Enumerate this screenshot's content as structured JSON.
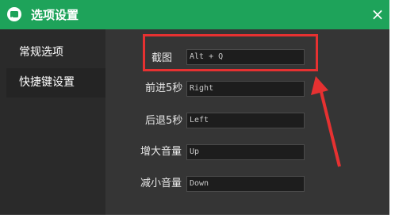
{
  "window": {
    "title": "选项设置",
    "close": "×"
  },
  "sidebar": {
    "items": [
      {
        "label": "常规选项"
      },
      {
        "label": "快捷键设置"
      }
    ]
  },
  "shortcuts": [
    {
      "label": "截图",
      "value": "Alt + Q"
    },
    {
      "label": "前进5秒",
      "value": "Right"
    },
    {
      "label": "后退5秒",
      "value": "Left"
    },
    {
      "label": "增大音量",
      "value": "Up"
    },
    {
      "label": "减小音量",
      "value": "Down"
    }
  ],
  "colors": {
    "titlebar": "#1ea35a",
    "annotation": "#e63131"
  }
}
